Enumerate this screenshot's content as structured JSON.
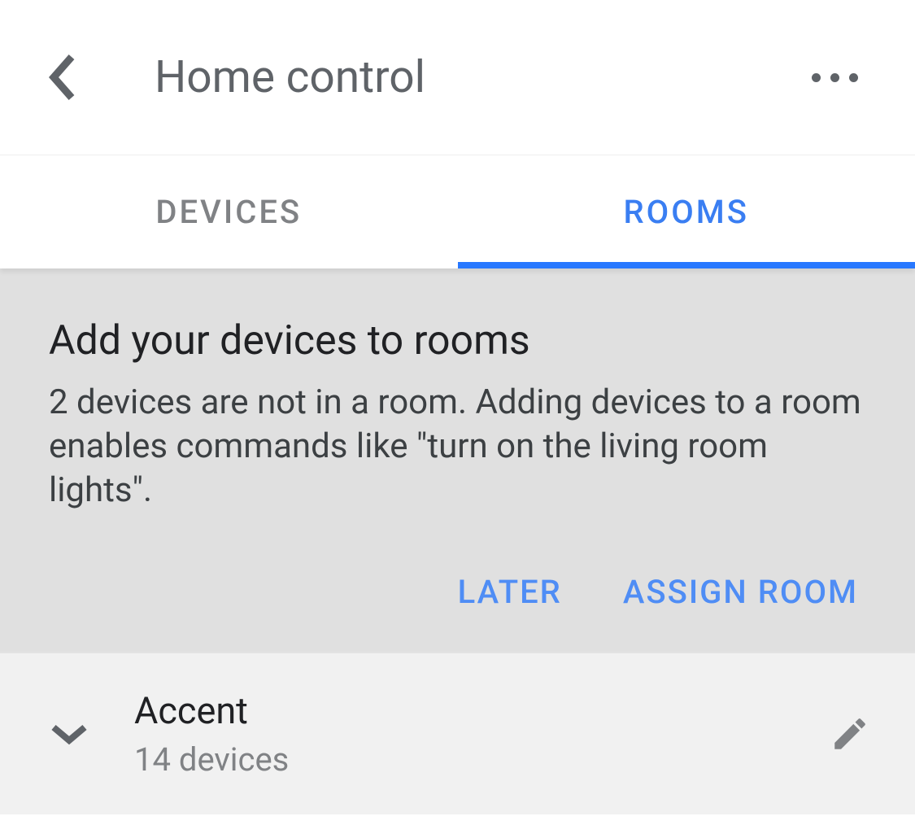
{
  "header": {
    "title": "Home control"
  },
  "tabs": [
    {
      "label": "DEVICES",
      "active": false
    },
    {
      "label": "ROOMS",
      "active": true
    }
  ],
  "prompt": {
    "title": "Add your devices to rooms",
    "description": "2 devices are not in a room. Adding devices to a room enables commands like \"turn on the living room lights\".",
    "actions": {
      "later": "LATER",
      "assign": "ASSIGN ROOM"
    }
  },
  "rooms": [
    {
      "name": "Accent",
      "subtitle": "14 devices"
    }
  ]
}
